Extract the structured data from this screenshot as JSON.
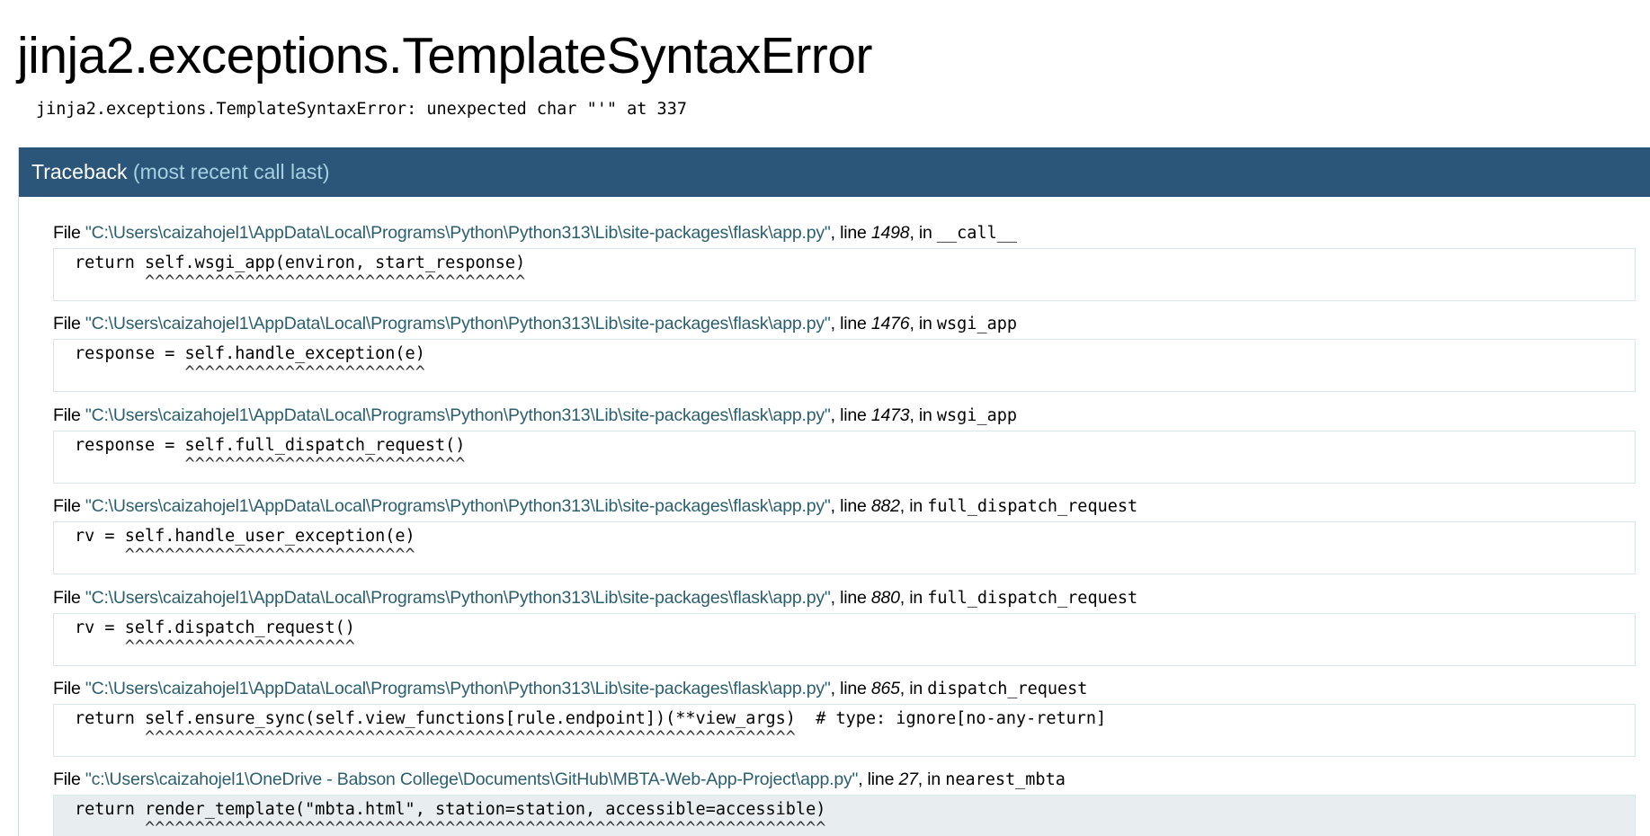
{
  "title": "jinja2.exceptions.TemplateSyntaxError",
  "error_message": "jinja2.exceptions.TemplateSyntaxError: unexpected char \"'\" at 337",
  "traceback": {
    "heading": "Traceback",
    "heading_sub": "(most recent call last)"
  },
  "frame_labels": {
    "file": "File ",
    "line": ", line ",
    "in": ", in "
  },
  "frames": [
    {
      "path": "\"C:\\Users\\caizahojel1\\AppData\\Local\\Programs\\Python\\Python313\\Lib\\site-packages\\flask\\app.py\"",
      "line": "1498",
      "func": "__call__",
      "code": "return self.wsgi_app(environ, start_response)",
      "carets": "       ^^^^^^^^^^^^^^^^^^^^^^^^^^^^^^^^^^^^^^"
    },
    {
      "path": "\"C:\\Users\\caizahojel1\\AppData\\Local\\Programs\\Python\\Python313\\Lib\\site-packages\\flask\\app.py\"",
      "line": "1476",
      "func": "wsgi_app",
      "code": "response = self.handle_exception(e)",
      "carets": "           ^^^^^^^^^^^^^^^^^^^^^^^^"
    },
    {
      "path": "\"C:\\Users\\caizahojel1\\AppData\\Local\\Programs\\Python\\Python313\\Lib\\site-packages\\flask\\app.py\"",
      "line": "1473",
      "func": "wsgi_app",
      "code": "response = self.full_dispatch_request()",
      "carets": "           ^^^^^^^^^^^^^^^^^^^^^^^^^^^^"
    },
    {
      "path": "\"C:\\Users\\caizahojel1\\AppData\\Local\\Programs\\Python\\Python313\\Lib\\site-packages\\flask\\app.py\"",
      "line": "882",
      "func": "full_dispatch_request",
      "code": "rv = self.handle_user_exception(e)",
      "carets": "     ^^^^^^^^^^^^^^^^^^^^^^^^^^^^^"
    },
    {
      "path": "\"C:\\Users\\caizahojel1\\AppData\\Local\\Programs\\Python\\Python313\\Lib\\site-packages\\flask\\app.py\"",
      "line": "880",
      "func": "full_dispatch_request",
      "code": "rv = self.dispatch_request()",
      "carets": "     ^^^^^^^^^^^^^^^^^^^^^^^"
    },
    {
      "path": "\"C:\\Users\\caizahojel1\\AppData\\Local\\Programs\\Python\\Python313\\Lib\\site-packages\\flask\\app.py\"",
      "line": "865",
      "func": "dispatch_request",
      "code": "return self.ensure_sync(self.view_functions[rule.endpoint])(**view_args)  # type: ignore[no-any-return]",
      "carets": "       ^^^^^^^^^^^^^^^^^^^^^^^^^^^^^^^^^^^^^^^^^^^^^^^^^^^^^^^^^^^^^^^^^"
    },
    {
      "path": "\"c:\\Users\\caizahojel1\\OneDrive - Babson College\\Documents\\GitHub\\MBTA-Web-App-Project\\app.py\"",
      "line": "27",
      "func": "nearest_mbta",
      "code": "return render_template(\"mbta.html\", station=station, accessible=accessible)",
      "carets": "       ^^^^^^^^^^^^^^^^^^^^^^^^^^^^^^^^^^^^^^^^^^^^^^^^^^^^^^^^^^^^^^^^^^^^",
      "current": true
    }
  ]
}
